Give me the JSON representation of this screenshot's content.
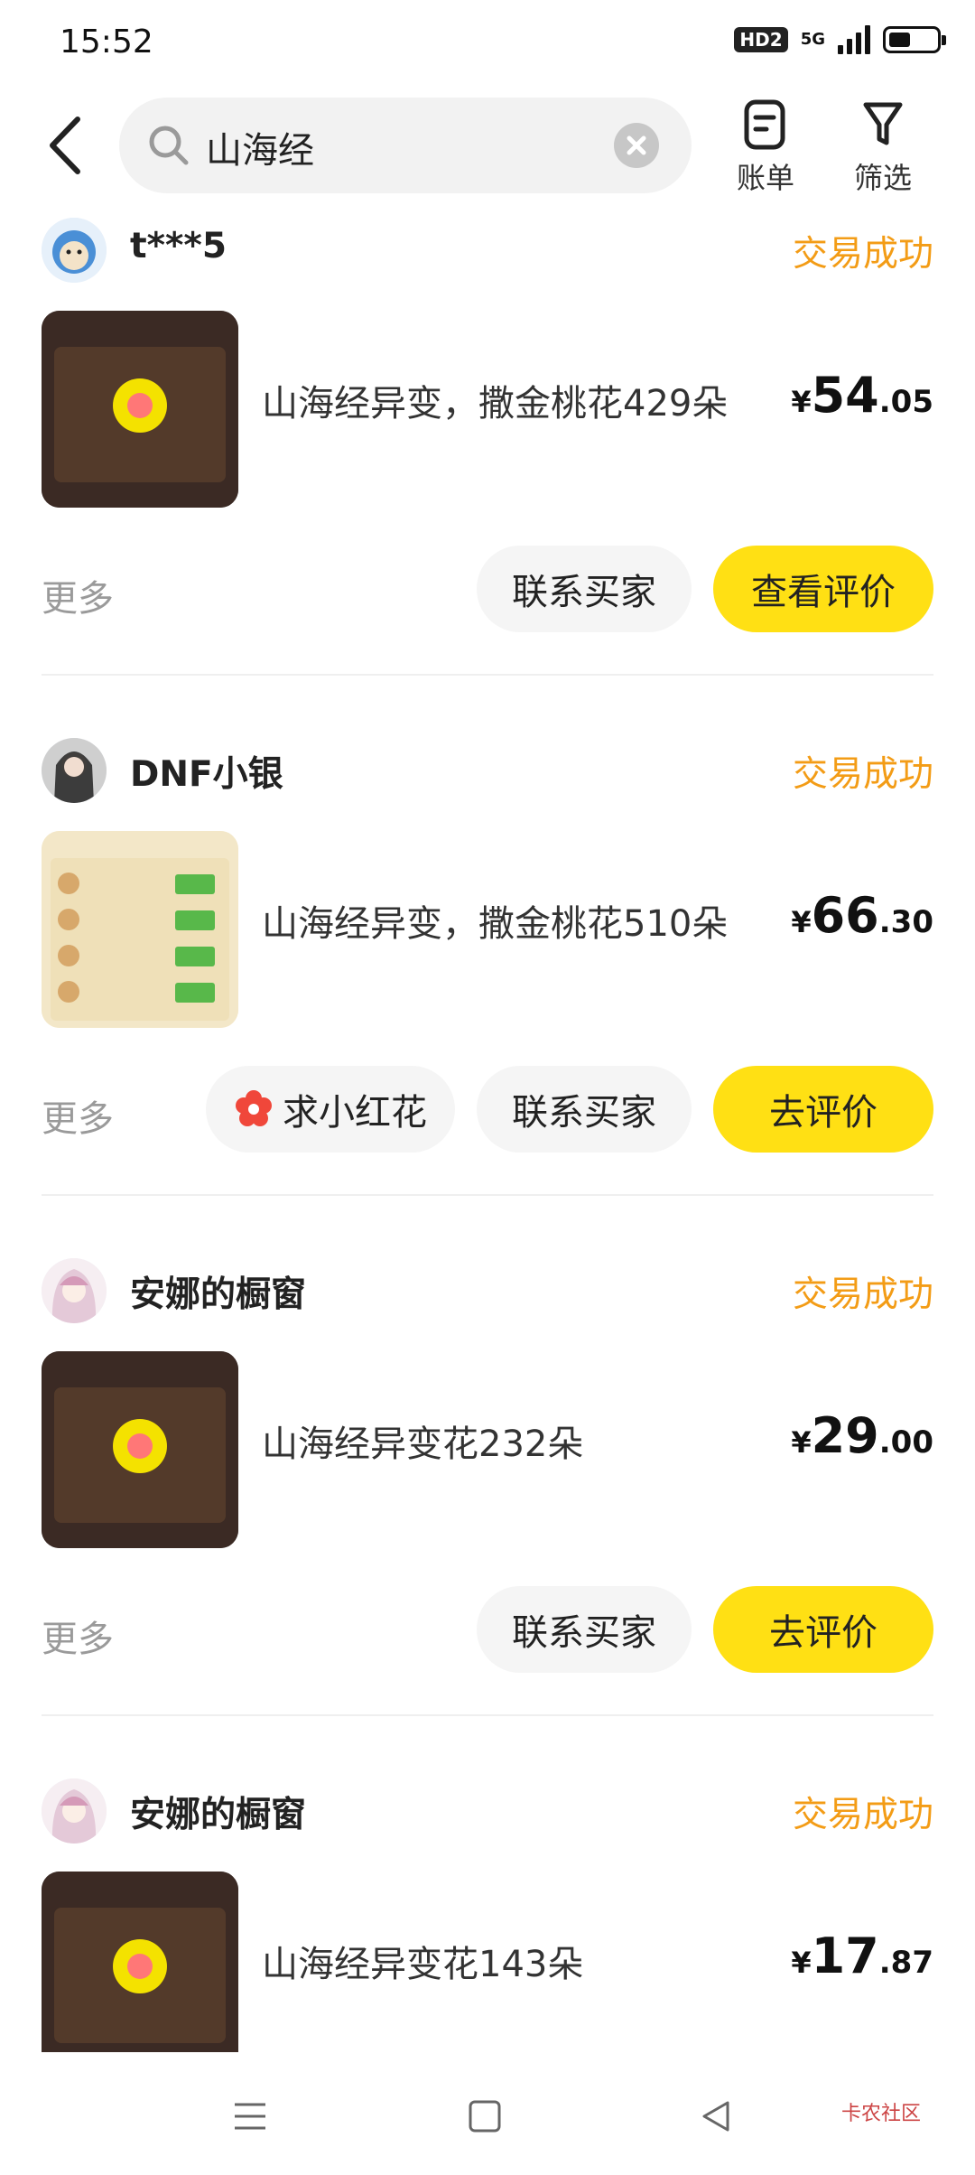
{
  "status_bar": {
    "time": "15:52",
    "hd": "HD2",
    "network": "5G"
  },
  "header": {
    "search_query": "山海经",
    "bill_label": "账单",
    "filter_label": "筛选"
  },
  "orders": [
    {
      "user": "t***5",
      "status": "交易成功",
      "title": "山海经异变，撒金桃花429朵",
      "price_currency": "¥",
      "price_int": "54",
      "price_dec": ".05",
      "more_label": "更多",
      "contact_label": "联系买家",
      "primary_label": "查看评价"
    },
    {
      "user": "DNF小银",
      "status": "交易成功",
      "title": "山海经异变，撒金桃花510朵",
      "price_currency": "¥",
      "price_int": "66",
      "price_dec": ".30",
      "more_label": "更多",
      "flower_label": "求小红花",
      "contact_label": "联系买家",
      "primary_label": "去评价"
    },
    {
      "user": "安娜的橱窗",
      "status": "交易成功",
      "title": "山海经异变花232朵",
      "price_currency": "¥",
      "price_int": "29",
      "price_dec": ".00",
      "more_label": "更多",
      "contact_label": "联系买家",
      "primary_label": "去评价"
    },
    {
      "user": "安娜的橱窗",
      "status": "交易成功",
      "title": "山海经异变花143朵",
      "price_currency": "¥",
      "price_int": "17",
      "price_dec": ".87"
    }
  ],
  "watermark": "卡农社区"
}
